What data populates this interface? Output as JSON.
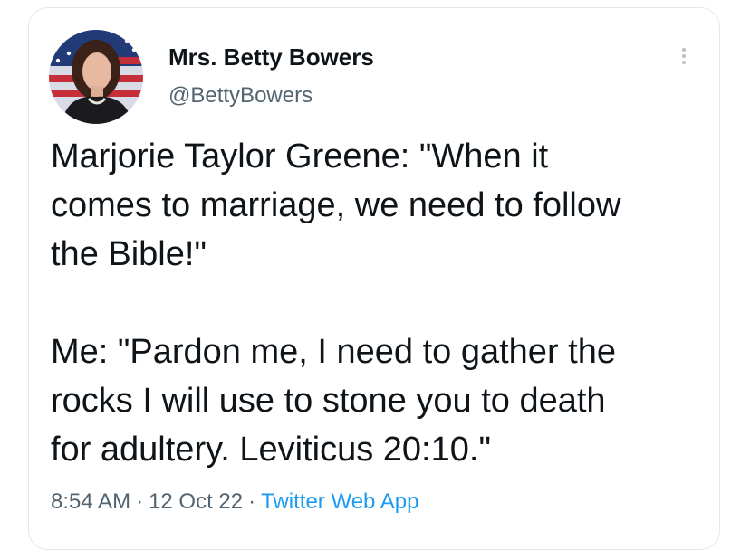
{
  "author": {
    "display_name": "Mrs. Betty Bowers",
    "handle": "@BettyBowers",
    "avatar": "profile-photo"
  },
  "tweet": {
    "paragraphs": [
      "Marjorie Taylor Greene: \"When it\ncomes to marriage, we need to follow\nthe Bible!\"",
      "Me: \"Pardon me, I need to gather the\nrocks I will use to stone you to death\nfor adultery. Leviticus 20:10.\""
    ],
    "time": "8:54 AM",
    "date": "12 Oct 22",
    "source": "Twitter Web App",
    "separator": "·"
  },
  "icons": {
    "more": "more-vertical-icon"
  },
  "colors": {
    "text": "#0f1419",
    "secondary": "#536471",
    "link": "#1d9bf0",
    "border": "#e6e6e6"
  }
}
